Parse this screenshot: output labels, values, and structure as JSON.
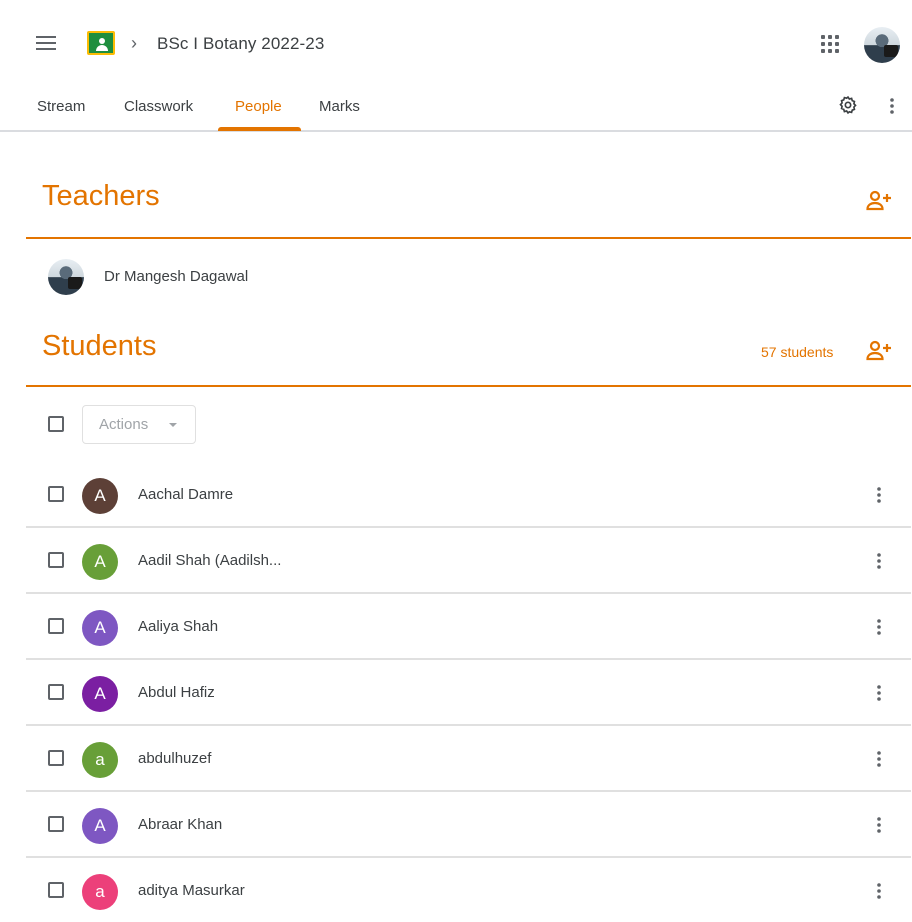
{
  "header": {
    "breadcrumb_chevron": "›",
    "class_title": "BSc I Botany 2022-23"
  },
  "tabs": [
    {
      "label": "Stream"
    },
    {
      "label": "Classwork"
    },
    {
      "label": "People",
      "active": true
    },
    {
      "label": "Marks"
    }
  ],
  "teachers": {
    "title": "Teachers",
    "list": [
      {
        "name": "Dr Mangesh Dagawal"
      }
    ]
  },
  "students": {
    "title": "Students",
    "count_label": "57 students",
    "actions_label": "Actions",
    "list": [
      {
        "name": "Aachal Damre",
        "initial": "A",
        "color": "#5d4037"
      },
      {
        "name": "Aadil Shah (Aadilsh...",
        "initial": "A",
        "color": "#689f38"
      },
      {
        "name": "Aaliya Shah",
        "initial": "A",
        "color": "#7e57c2"
      },
      {
        "name": "Abdul Hafiz",
        "initial": "A",
        "color": "#7b1fa2"
      },
      {
        "name": "abdulhuzef",
        "initial": "a",
        "color": "#689f38"
      },
      {
        "name": "Abraar Khan",
        "initial": "A",
        "color": "#7e57c2"
      },
      {
        "name": "aditya Masurkar",
        "initial": "a",
        "color": "#ec407a"
      }
    ]
  },
  "colors": {
    "accent": "#e37400",
    "divider": "#e0e0e0"
  },
  "icons": [
    "menu-icon",
    "classroom-logo-icon",
    "chevron-right-icon",
    "apps-grid-icon",
    "gear-icon",
    "more-vert-icon",
    "add-person-icon"
  ]
}
